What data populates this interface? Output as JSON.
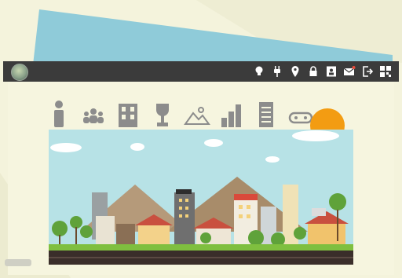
{
  "app": {
    "logo": "globe-logo-icon"
  },
  "toolbar": {
    "icons": [
      "lightbulb-icon",
      "plug-icon",
      "location-pin-icon",
      "lock-icon",
      "contacts-icon",
      "mail-icon",
      "logout-icon",
      "qr-code-icon"
    ]
  },
  "nav": {
    "icons": [
      "person-icon",
      "group-icon",
      "building-icon",
      "trophy-icon",
      "map-icon",
      "bar-chart-icon",
      "document-icon",
      "gamepad-icon"
    ]
  },
  "colors": {
    "topbar": "#3b3b3b",
    "page_bg": "#f4f3dc",
    "blue_panel": "#8fcbd9",
    "icon_gray": "#8c8c8c",
    "sky": "#b7e2e6",
    "sun": "#f39c12"
  }
}
